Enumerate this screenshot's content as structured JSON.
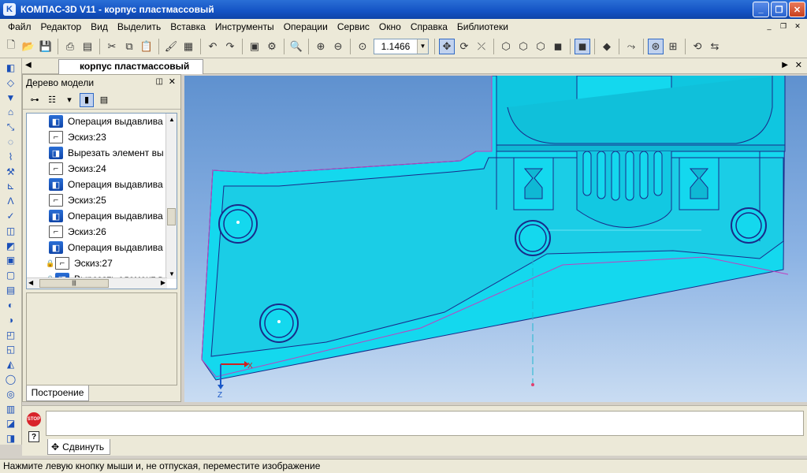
{
  "window": {
    "title": "КОМПАС-3D V11 - корпус пластмассовый",
    "logo_letter": "K",
    "minimize_label": "_",
    "restore_label": "❐",
    "close_label": "✕"
  },
  "menu": {
    "items": [
      "Файл",
      "Редактор",
      "Вид",
      "Выделить",
      "Вставка",
      "Инструменты",
      "Операции",
      "Сервис",
      "Окно",
      "Справка",
      "Библиотеки"
    ]
  },
  "toolbar": {
    "zoom_value": "1.1466"
  },
  "document": {
    "tab_title": "корпус пластмассовый"
  },
  "tree_panel": {
    "title": "Дерево модели",
    "bottom_tab": "Построение",
    "items": [
      {
        "label": "Операция выдавлива",
        "type": "op"
      },
      {
        "label": "Эскиз:23",
        "type": "sketch"
      },
      {
        "label": "Вырезать элемент вы",
        "type": "op"
      },
      {
        "label": "Эскиз:24",
        "type": "sketch"
      },
      {
        "label": "Операция выдавлива",
        "type": "op"
      },
      {
        "label": "Эскиз:25",
        "type": "sketch"
      },
      {
        "label": "Операция выдавлива",
        "type": "op"
      },
      {
        "label": "Эскиз:26",
        "type": "sketch"
      },
      {
        "label": "Операция выдавлива",
        "type": "op"
      },
      {
        "label": "Эскиз:27",
        "type": "sketch",
        "locked": true
      },
      {
        "label": "Вырезать элемент в",
        "type": "op",
        "locked": true
      }
    ]
  },
  "viewport": {
    "axis_x": "X",
    "axis_z": "Z",
    "colors": {
      "model": "#14d8ee",
      "model_dark": "#0fb8d4",
      "outline": "#1a2a8a",
      "edge": "#c040c0"
    }
  },
  "prop_panel": {
    "tab_label": "Сдвинуть",
    "stop_label": "STOP",
    "help_label": "?"
  },
  "status": {
    "text": "Нажмите левую кнопку мыши и, не отпуская, переместите изображение"
  }
}
